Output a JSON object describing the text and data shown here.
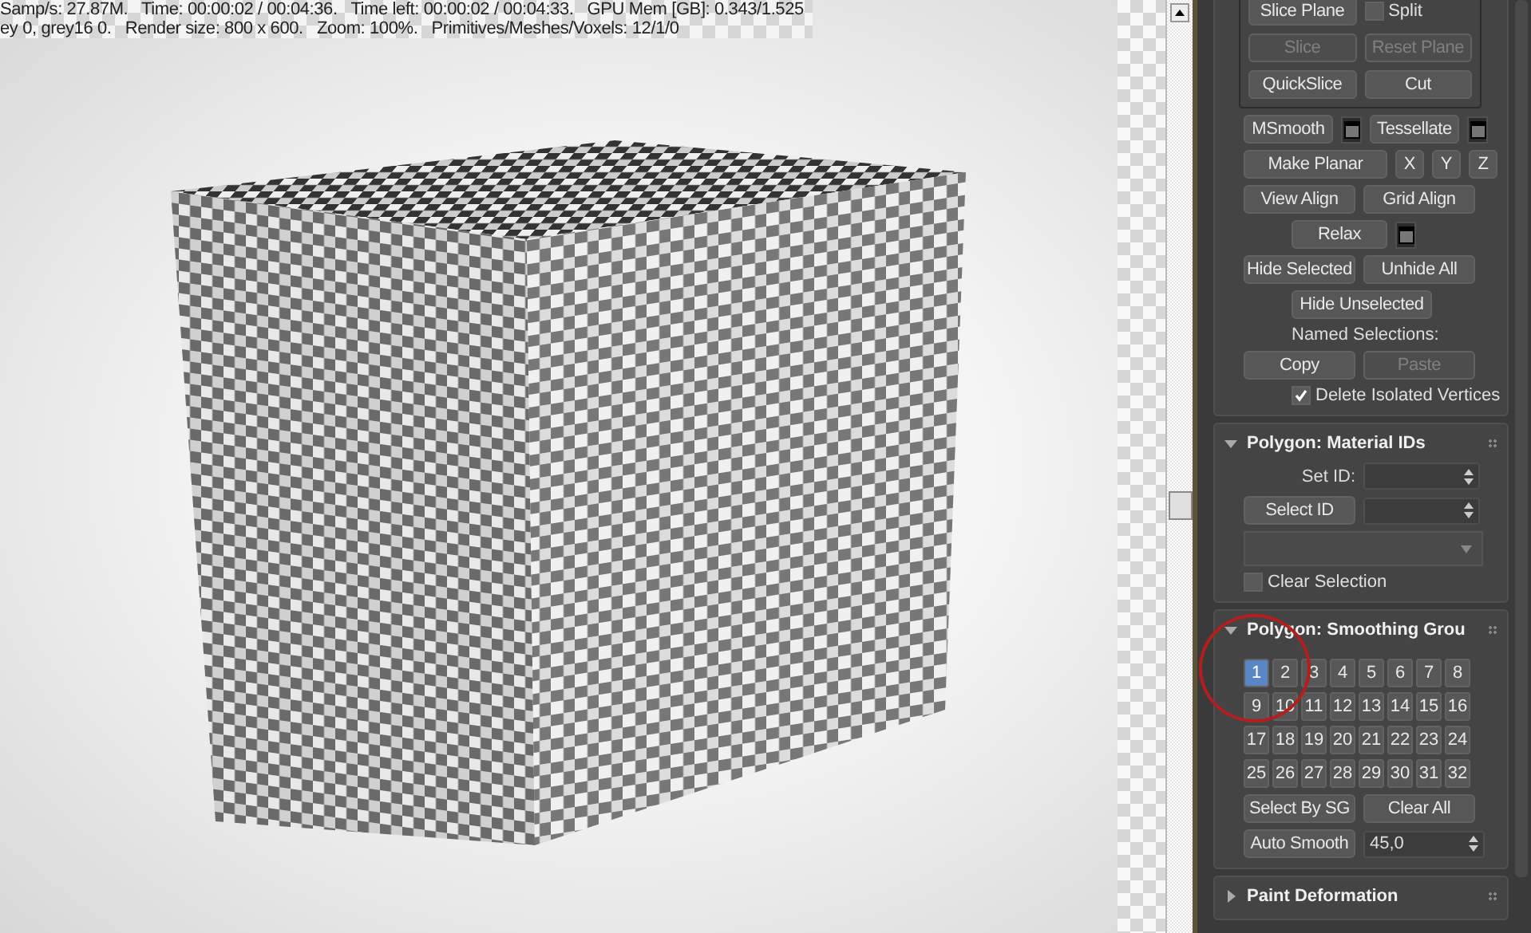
{
  "status_lines": [
    "Samp/s: 27.87M.   Time: 00:00:02 / 00:04:36.   Time left: 00:00:02 / 00:04:33.   GPU Mem [GB]: 0.343/1.525",
    "ey 0, grey16 0.   Render size: 800 x 600.   Zoom: 100%.   Primitives/Meshes/Voxels: 12/1/0"
  ],
  "edit_group": [
    [
      {
        "kind": "button",
        "label": "Slice Plane",
        "disabled": false
      },
      {
        "kind": "checkbox",
        "label": "Split",
        "checked": false
      }
    ],
    [
      {
        "kind": "button",
        "label": "Slice",
        "disabled": true
      },
      {
        "kind": "button",
        "label": "Reset Plane",
        "disabled": true
      }
    ],
    [
      {
        "kind": "button",
        "label": "QuickSlice",
        "disabled": false
      },
      {
        "kind": "button",
        "label": "Cut",
        "disabled": false
      }
    ]
  ],
  "edit_rows": [
    [
      {
        "kind": "button",
        "label": "MSmooth",
        "disabled": false
      },
      {
        "kind": "settings"
      },
      {
        "kind": "button",
        "label": "Tessellate",
        "disabled": false
      },
      {
        "kind": "settings"
      }
    ],
    [
      {
        "kind": "button",
        "label": "Make Planar",
        "disabled": false
      },
      {
        "kind": "small",
        "label": "X",
        "disabled": false
      },
      {
        "kind": "small",
        "label": "Y",
        "disabled": false
      },
      {
        "kind": "small",
        "label": "Z",
        "disabled": false
      }
    ],
    [
      {
        "kind": "button",
        "label": "View Align",
        "disabled": false
      },
      {
        "kind": "button",
        "label": "Grid Align",
        "disabled": false
      }
    ],
    [
      {
        "kind": "button",
        "label": "Relax",
        "disabled": false
      },
      {
        "kind": "settings"
      }
    ],
    [
      {
        "kind": "button",
        "label": "Hide Selected",
        "disabled": false
      },
      {
        "kind": "button",
        "label": "Unhide All",
        "disabled": false
      }
    ],
    [
      {
        "kind": "button",
        "label": "Hide Unselected",
        "disabled": false
      }
    ],
    [
      {
        "kind": "label",
        "label": "Named Selections:"
      }
    ],
    [
      {
        "kind": "button",
        "label": "Copy",
        "disabled": false
      },
      {
        "kind": "button",
        "label": "Paste",
        "disabled": true
      }
    ],
    [
      {
        "kind": "checkbox",
        "label": "Delete Isolated Vertices",
        "checked": true
      }
    ]
  ],
  "material_ids": {
    "title": "Polygon: Material IDs",
    "expanded": true,
    "set_id_label": "Set ID:",
    "select_id_button": "Select ID",
    "clear_selection": {
      "label": "Clear Selection",
      "checked": false
    }
  },
  "smoothing_groups": {
    "title": "Polygon: Smoothing Grou",
    "expanded": true,
    "groups": [
      {
        "label": "1",
        "selected": true
      },
      {
        "label": "2",
        "selected": false
      },
      {
        "label": "3",
        "selected": false
      },
      {
        "label": "4",
        "selected": false
      },
      {
        "label": "5",
        "selected": false
      },
      {
        "label": "6",
        "selected": false
      },
      {
        "label": "7",
        "selected": false
      },
      {
        "label": "8",
        "selected": false
      },
      {
        "label": "9",
        "selected": false
      },
      {
        "label": "10",
        "selected": false
      },
      {
        "label": "11",
        "selected": false
      },
      {
        "label": "12",
        "selected": false
      },
      {
        "label": "13",
        "selected": false
      },
      {
        "label": "14",
        "selected": false
      },
      {
        "label": "15",
        "selected": false
      },
      {
        "label": "16",
        "selected": false
      },
      {
        "label": "17",
        "selected": false
      },
      {
        "label": "18",
        "selected": false
      },
      {
        "label": "19",
        "selected": false
      },
      {
        "label": "20",
        "selected": false
      },
      {
        "label": "21",
        "selected": false
      },
      {
        "label": "22",
        "selected": false
      },
      {
        "label": "23",
        "selected": false
      },
      {
        "label": "24",
        "selected": false
      },
      {
        "label": "25",
        "selected": false
      },
      {
        "label": "26",
        "selected": false
      },
      {
        "label": "27",
        "selected": false
      },
      {
        "label": "28",
        "selected": false
      },
      {
        "label": "29",
        "selected": false
      },
      {
        "label": "30",
        "selected": false
      },
      {
        "label": "31",
        "selected": false
      },
      {
        "label": "32",
        "selected": false
      }
    ],
    "select_by_sg": "Select By SG",
    "clear_all": "Clear All",
    "auto_smooth": "Auto Smooth",
    "threshold": "45,0"
  },
  "paint_deformation": {
    "title": "Paint Deformation",
    "expanded": false
  }
}
